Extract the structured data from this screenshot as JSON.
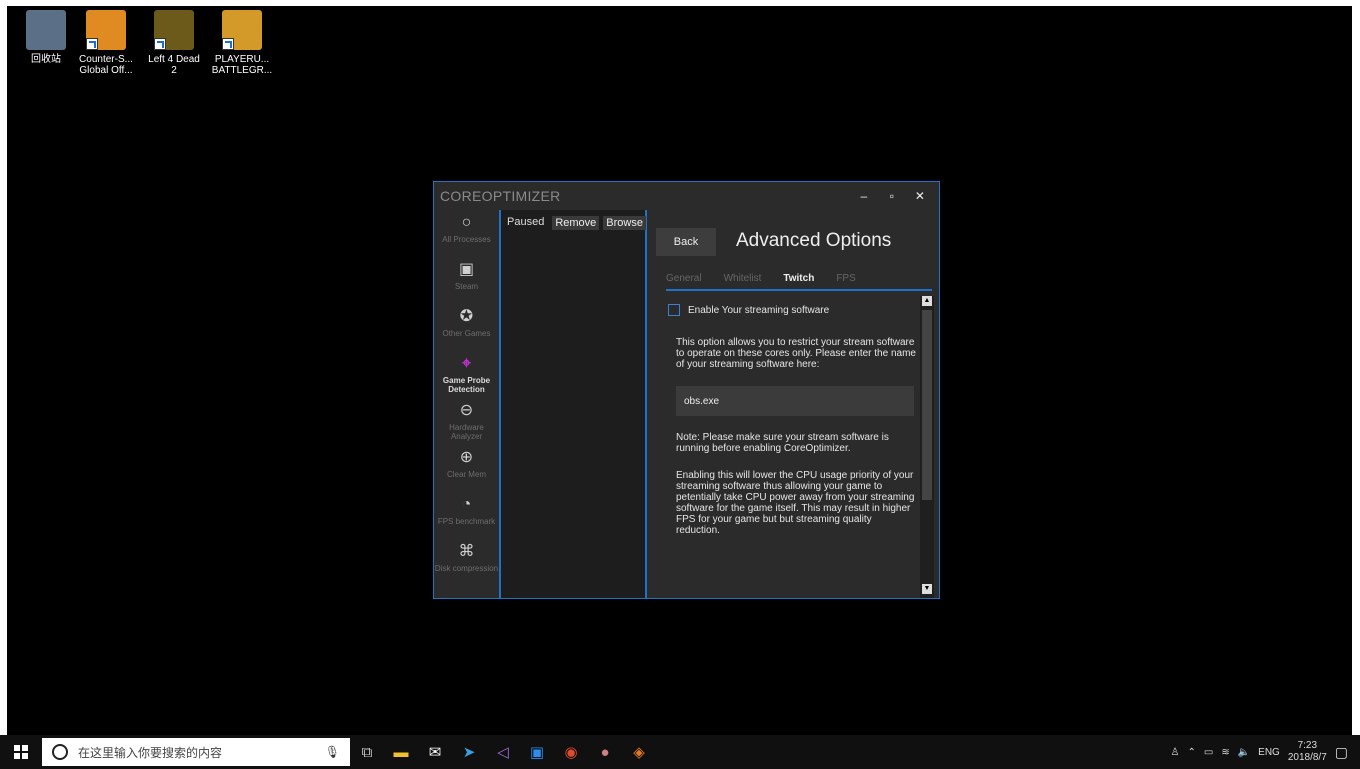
{
  "desktop": {
    "icons": [
      {
        "label_1": "回收站",
        "label_2": "",
        "name": "recycle-bin-icon"
      },
      {
        "label_1": "Counter-S...",
        "label_2": "Global Off...",
        "name": "csgo-icon"
      },
      {
        "label_1": "Left 4 Dead",
        "label_2": "2",
        "name": "left4dead2-icon"
      },
      {
        "label_1": "PLAYERU...",
        "label_2": "BATTLEGR...",
        "name": "pubg-icon"
      }
    ]
  },
  "window": {
    "title": "COREOPTIMIZER",
    "controls": {
      "minimize": "‒",
      "maximize": "▫",
      "close": "✕"
    },
    "sidebar": [
      {
        "label": "All Processes",
        "icon": "○"
      },
      {
        "label": "Steam",
        "icon": "▣"
      },
      {
        "label": "Other Games",
        "icon": "✪"
      },
      {
        "label": "Game Probe Detection",
        "icon": "⌖"
      },
      {
        "label": "Hardware Analyzer",
        "icon": "⊖"
      },
      {
        "label": "Clear Mem",
        "icon": "⊕"
      },
      {
        "label": "FPS benchmark",
        "icon": "◔"
      },
      {
        "label": "Disk compression",
        "icon": "⌘"
      }
    ],
    "process_panel": {
      "status": "Paused",
      "remove": "Remove",
      "browse": "Browse"
    },
    "advanced": {
      "back": "Back",
      "title": "Advanced Options",
      "tabs": [
        "General",
        "Whitelist",
        "Twitch",
        "FPS"
      ],
      "enable_label": "Enable Your streaming software",
      "para1": "This option allows you to restrict your stream software to operate on these cores only. Please enter the name of your streaming software here:",
      "input_value": "obs.exe",
      "para2": "Note: Please make sure your stream software is running before enabling CoreOptimizer.",
      "para3": "Enabling this will lower the CPU usage priority of your streaming software thus allowing your game to petentially take CPU power away from your streaming software for the game itself. This may result in higher FPS for your game but but streaming quality reduction."
    }
  },
  "taskbar": {
    "search_placeholder": "在这里输入你要搜索的内容",
    "language": "ENG",
    "time": "7:23",
    "date": "2018/8/7"
  },
  "colors": {
    "accent": "#1e73c8",
    "active_icon": "#c02fcf"
  }
}
